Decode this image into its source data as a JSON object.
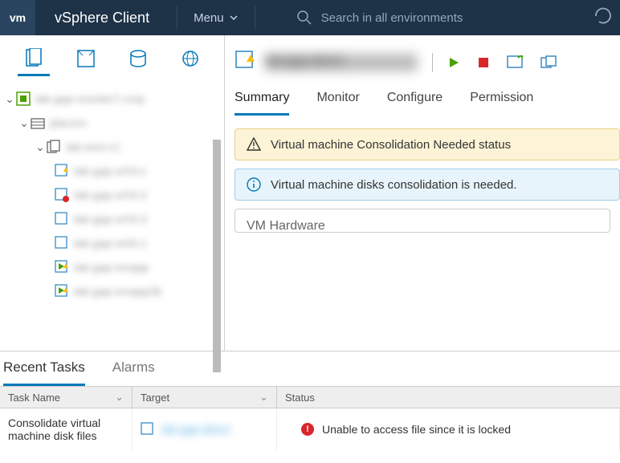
{
  "topbar": {
    "logo": "vm",
    "title": "vSphere Client",
    "menu_label": "Menu",
    "search_placeholder": "Search in all environments"
  },
  "sidebar": {
    "tree": {
      "vcenter": "lab-gap-vcenter7.corp",
      "datacenter": "placorn",
      "cluster": "lab-esxi-c1",
      "vms": [
        {
          "name": "lab-gap-vr03-c",
          "state": "warn"
        },
        {
          "name": "lab-gap-vr03-2",
          "state": "alert"
        },
        {
          "name": "lab-gap-vr03-3",
          "state": "normal"
        },
        {
          "name": "lab-gap-vr04-1",
          "state": "normal"
        },
        {
          "name": "lab-gap-srvapp",
          "state": "running-warn"
        },
        {
          "name": "lab-gap-srvapp2b",
          "state": "running-warn"
        }
      ]
    }
  },
  "content": {
    "vm_title": "lab-gap-direct",
    "tabs": [
      "Summary",
      "Monitor",
      "Configure",
      "Permission"
    ],
    "active_tab": "Summary",
    "alerts": {
      "warning": "Virtual machine Consolidation Needed status",
      "info": "Virtual machine disks consolidation is needed."
    },
    "panel_title": "VM Hardware"
  },
  "bottom": {
    "tabs": {
      "recent": "Recent Tasks",
      "alarms": "Alarms"
    },
    "columns": {
      "name": "Task Name",
      "target": "Target",
      "status": "Status"
    },
    "rows": [
      {
        "name": "Consolidate virtual machine disk files",
        "target": "lab-gap-direct",
        "status": "Unable to access file since it is locked"
      }
    ]
  }
}
